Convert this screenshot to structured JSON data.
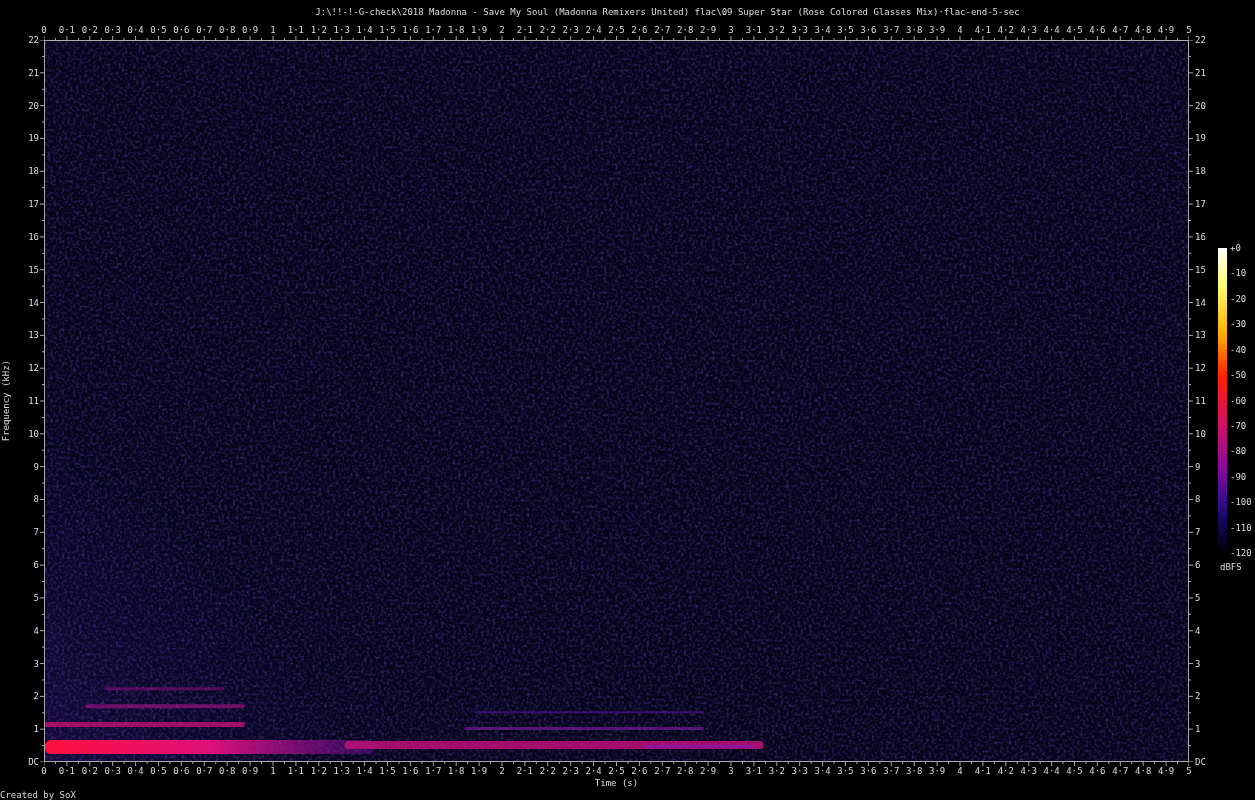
{
  "title": "J:\\!!-!-G-check\\2018 Madonna - Save My Soul (Madonna Remixers United) flac\\09 Super Star (Rose Colored Glasses Mix)·flac-end-5-sec",
  "top_axis": {
    "labels": [
      "0",
      "0·1",
      "0·2",
      "0·3",
      "0·4",
      "0·5",
      "0·6",
      "0·7",
      "0·8",
      "0·9",
      "1",
      "1·1",
      "1·2",
      "1·3",
      "1·4",
      "1·5",
      "1·6",
      "1·7",
      "1·8",
      "1·9",
      "2",
      "2·1",
      "2·2",
      "2·3",
      "2·4",
      "2·5",
      "2·6",
      "2·7",
      "2·8",
      "2·9",
      "3",
      "3·1",
      "3·2",
      "3·3",
      "3·4",
      "3·5",
      "3·6",
      "3·7",
      "3·8",
      "3·9",
      "4",
      "4·1",
      "4·2",
      "4·3",
      "4·4",
      "4·5",
      "4·6",
      "4·7",
      "4·8",
      "4·9",
      "5"
    ]
  },
  "left_axis": {
    "title": "Frequency (kHz)",
    "labels": [
      "22",
      "21",
      "20",
      "19",
      "18",
      "17",
      "16",
      "15",
      "14",
      "13",
      "12",
      "11",
      "10",
      "9",
      "8",
      "7",
      "6",
      "5",
      "4",
      "3",
      "2",
      "1",
      "DC"
    ]
  },
  "right_axis": {
    "labels": [
      "22",
      "21",
      "20",
      "19",
      "18",
      "17",
      "16",
      "15",
      "14",
      "13",
      "12",
      "11",
      "10",
      "9",
      "8",
      "7",
      "6",
      "5",
      "4",
      "3",
      "2",
      "1",
      "DC"
    ]
  },
  "bottom_axis": {
    "title": "Time (s)",
    "labels": [
      "0",
      "0·1",
      "0·2",
      "0·3",
      "0·4",
      "0·5",
      "0·6",
      "0·7",
      "0·8",
      "0·9",
      "1",
      "1·1",
      "1·2",
      "1·3",
      "1·4",
      "1·5",
      "1·6",
      "1·7",
      "1·8",
      "1·9",
      "2",
      "2·1",
      "2·2",
      "2·3",
      "2·4",
      "2·5",
      "2·6",
      "2·7",
      "2·8",
      "2·9",
      "3",
      "3·1",
      "3·2",
      "3·3",
      "3·4",
      "3·5",
      "3·6",
      "3·7",
      "3·8",
      "3·9",
      "4",
      "4·1",
      "4·2",
      "4·3",
      "4·4",
      "4·5",
      "4·6",
      "4·7",
      "4·8",
      "4·9",
      "5"
    ]
  },
  "color_scale": {
    "unit": "dBFS",
    "labels": [
      "+0",
      "-10",
      "-20",
      "-30",
      "-40",
      "-50",
      "-60",
      "-70",
      "-80",
      "-90",
      "-100",
      "-110",
      "-120"
    ]
  },
  "footer": "Created by SoX"
}
